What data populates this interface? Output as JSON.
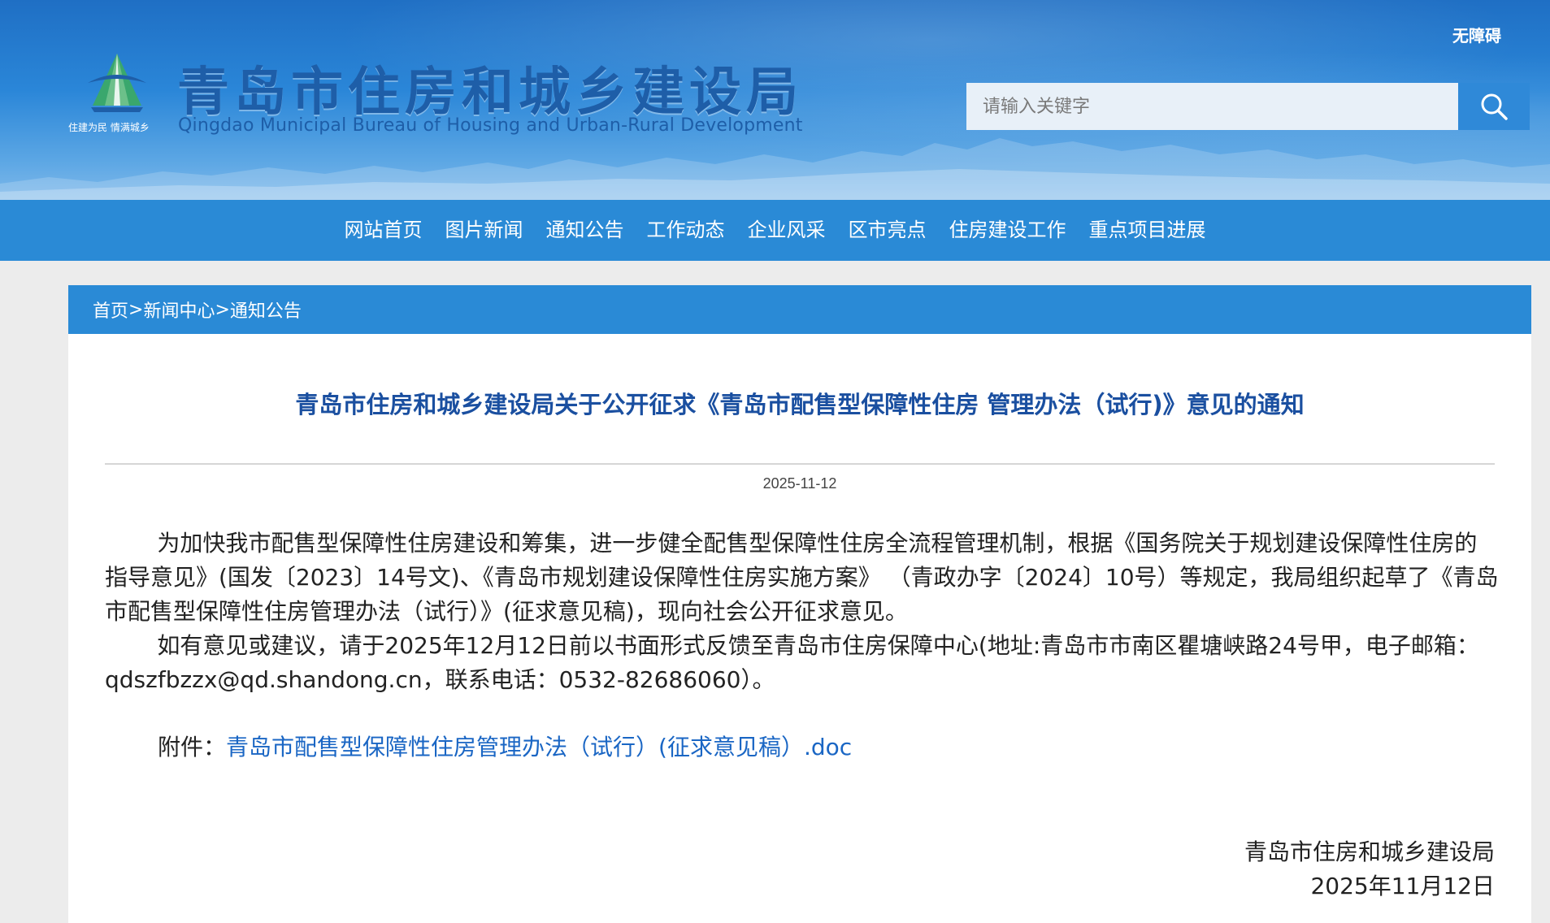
{
  "header": {
    "logo_slogan": "住建为民 情满城乡",
    "title_cn": "青岛市住房和城乡建设局",
    "title_en": "Qingdao Municipal Bureau of Housing and Urban-Rural Development",
    "accessibility_label": "无障碍",
    "search_placeholder": "请输入关键字"
  },
  "nav": {
    "items": [
      {
        "label": "网站首页"
      },
      {
        "label": "图片新闻"
      },
      {
        "label": "通知公告"
      },
      {
        "label": "工作动态"
      },
      {
        "label": "企业风采"
      },
      {
        "label": "区市亮点"
      },
      {
        "label": "住房建设工作"
      },
      {
        "label": "重点项目进展"
      }
    ]
  },
  "breadcrumb": {
    "home": "首页",
    "section": "新闻中心",
    "current": "通知公告",
    "separator": ">"
  },
  "article": {
    "title": "青岛市住房和城乡建设局关于公开征求《青岛市配售型保障性住房 管理办法（试行)》意见的通知",
    "date": "2025-11-12",
    "paragraph1": "为加快我市配售型保障性住房建设和筹集，进一步健全配售型保障性住房全流程管理机制，根据《国务院关于规划建设保障性住房的指导意见》(国发〔2023〕14号文)、《青岛市规划建设保障性住房实施方案》 （青政办字〔2024〕10号）等规定，我局组织起草了《青岛市配售型保障性住房管理办法（试行）》(征求意见稿)，现向社会公开征求意见。",
    "paragraph2": "如有意见或建议，请于2025年12月12日前以书面形式反馈至青岛市住房保障中心(地址:青岛市市南区瞿塘峡路24号甲，电子邮箱：qdszfbzzx@qd.shandong.cn，联系电话：0532-82686060）。",
    "attachment_label": "附件：",
    "attachment_link": "青岛市配售型保障性住房管理办法（试行）(征求意见稿）.doc",
    "signature_org": "青岛市住房和城乡建设局",
    "signature_date": "2025年11月12日"
  },
  "colors": {
    "nav_bg": "#2a8ad6",
    "title_blue": "#1a4fa0",
    "link_blue": "#1a66c4"
  },
  "icons": {
    "search": "search-icon",
    "logo": "bureau-emblem-icon"
  }
}
